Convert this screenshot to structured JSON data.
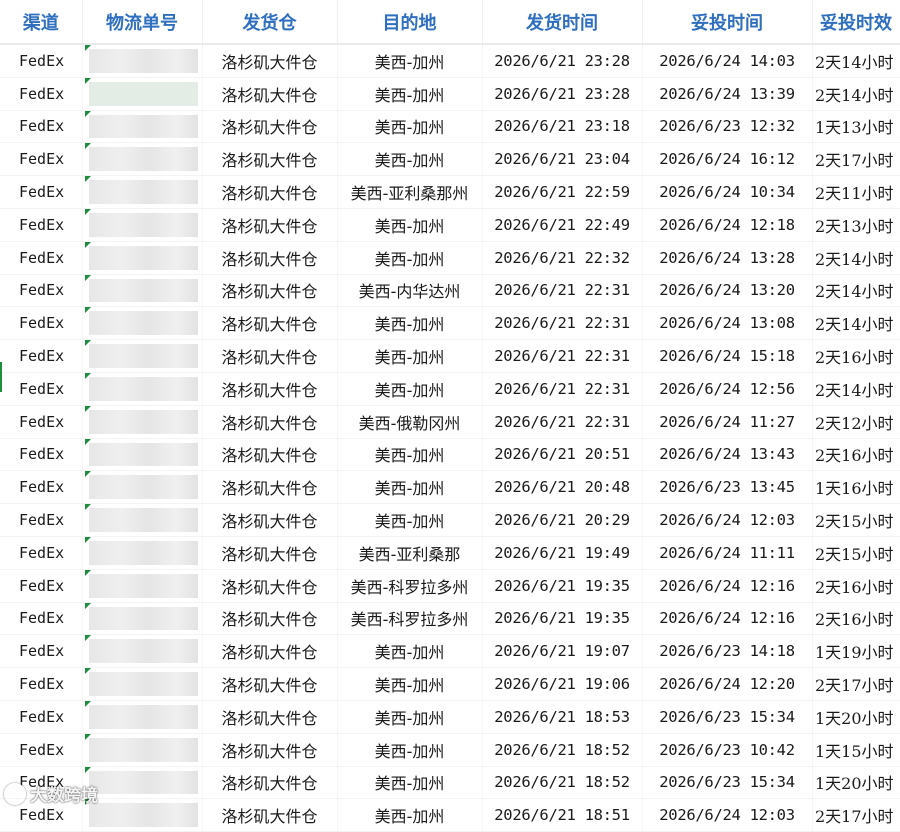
{
  "colors": {
    "header_text": "#2f6fbf",
    "accent_green": "#1e8e3e",
    "text": "#1a1a1a"
  },
  "table": {
    "headers": [
      "渠道",
      "物流单号",
      "发货仓",
      "目的地",
      "发货时间",
      "妥投时间",
      "妥投时效"
    ],
    "rows": [
      [
        "FedEx",
        "",
        "洛杉矶大件仓",
        "美西-加州",
        "2026/6/21 23:28",
        "2026/6/24 14:03",
        "2天14小时"
      ],
      [
        "FedEx",
        "",
        "洛杉矶大件仓",
        "美西-加州",
        "2026/6/21 23:28",
        "2026/6/24 13:39",
        "2天14小时"
      ],
      [
        "FedEx",
        "",
        "洛杉矶大件仓",
        "美西-加州",
        "2026/6/21 23:18",
        "2026/6/23 12:32",
        "1天13小时"
      ],
      [
        "FedEx",
        "",
        "洛杉矶大件仓",
        "美西-加州",
        "2026/6/21 23:04",
        "2026/6/24 16:12",
        "2天17小时"
      ],
      [
        "FedEx",
        "",
        "洛杉矶大件仓",
        "美西-亚利桑那州",
        "2026/6/21 22:59",
        "2026/6/24 10:34",
        "2天11小时"
      ],
      [
        "FedEx",
        "",
        "洛杉矶大件仓",
        "美西-加州",
        "2026/6/21 22:49",
        "2026/6/24 12:18",
        "2天13小时"
      ],
      [
        "FedEx",
        "",
        "洛杉矶大件仓",
        "美西-加州",
        "2026/6/21 22:32",
        "2026/6/24 13:28",
        "2天14小时"
      ],
      [
        "FedEx",
        "",
        "洛杉矶大件仓",
        "美西-内华达州",
        "2026/6/21 22:31",
        "2026/6/24 13:20",
        "2天14小时"
      ],
      [
        "FedEx",
        "",
        "洛杉矶大件仓",
        "美西-加州",
        "2026/6/21 22:31",
        "2026/6/24 13:08",
        "2天14小时"
      ],
      [
        "FedEx",
        "",
        "洛杉矶大件仓",
        "美西-加州",
        "2026/6/21 22:31",
        "2026/6/24 15:18",
        "2天16小时"
      ],
      [
        "FedEx",
        "",
        "洛杉矶大件仓",
        "美西-加州",
        "2026/6/21 22:31",
        "2026/6/24 12:56",
        "2天14小时"
      ],
      [
        "FedEx",
        "",
        "洛杉矶大件仓",
        "美西-俄勒冈州",
        "2026/6/21 22:31",
        "2026/6/24 11:27",
        "2天12小时"
      ],
      [
        "FedEx",
        "",
        "洛杉矶大件仓",
        "美西-加州",
        "2026/6/21 20:51",
        "2026/6/24 13:43",
        "2天16小时"
      ],
      [
        "FedEx",
        "",
        "洛杉矶大件仓",
        "美西-加州",
        "2026/6/21 20:48",
        "2026/6/23 13:45",
        "1天16小时"
      ],
      [
        "FedEx",
        "",
        "洛杉矶大件仓",
        "美西-加州",
        "2026/6/21 20:29",
        "2026/6/24 12:03",
        "2天15小时"
      ],
      [
        "FedEx",
        "",
        "洛杉矶大件仓",
        "美西-亚利桑那",
        "2026/6/21 19:49",
        "2026/6/24 11:11",
        "2天15小时"
      ],
      [
        "FedEx",
        "",
        "洛杉矶大件仓",
        "美西-科罗拉多州",
        "2026/6/21 19:35",
        "2026/6/24 12:16",
        "2天16小时"
      ],
      [
        "FedEx",
        "",
        "洛杉矶大件仓",
        "美西-科罗拉多州",
        "2026/6/21 19:35",
        "2026/6/24 12:16",
        "2天16小时"
      ],
      [
        "FedEx",
        "",
        "洛杉矶大件仓",
        "美西-加州",
        "2026/6/21 19:07",
        "2026/6/23 14:18",
        "1天19小时"
      ],
      [
        "FedEx",
        "",
        "洛杉矶大件仓",
        "美西-加州",
        "2026/6/21 19:06",
        "2026/6/24 12:20",
        "2天17小时"
      ],
      [
        "FedEx",
        "",
        "洛杉矶大件仓",
        "美西-加州",
        "2026/6/21 18:53",
        "2026/6/23 15:34",
        "1天20小时"
      ],
      [
        "FedEx",
        "",
        "洛杉矶大件仓",
        "美西-加州",
        "2026/6/21 18:52",
        "2026/6/23 10:42",
        "1天15小时"
      ],
      [
        "FedEx",
        "",
        "洛杉矶大件仓",
        "美西-加州",
        "2026/6/21 18:52",
        "2026/6/23 15:34",
        "1天20小时"
      ],
      [
        "FedEx",
        "",
        "洛杉矶大件仓",
        "美西-加州",
        "2026/6/21 18:51",
        "2026/6/24 12:03",
        "2天17小时"
      ]
    ]
  },
  "watermark": {
    "text": "大数跨境",
    "icon": "brand-logo-icon"
  }
}
